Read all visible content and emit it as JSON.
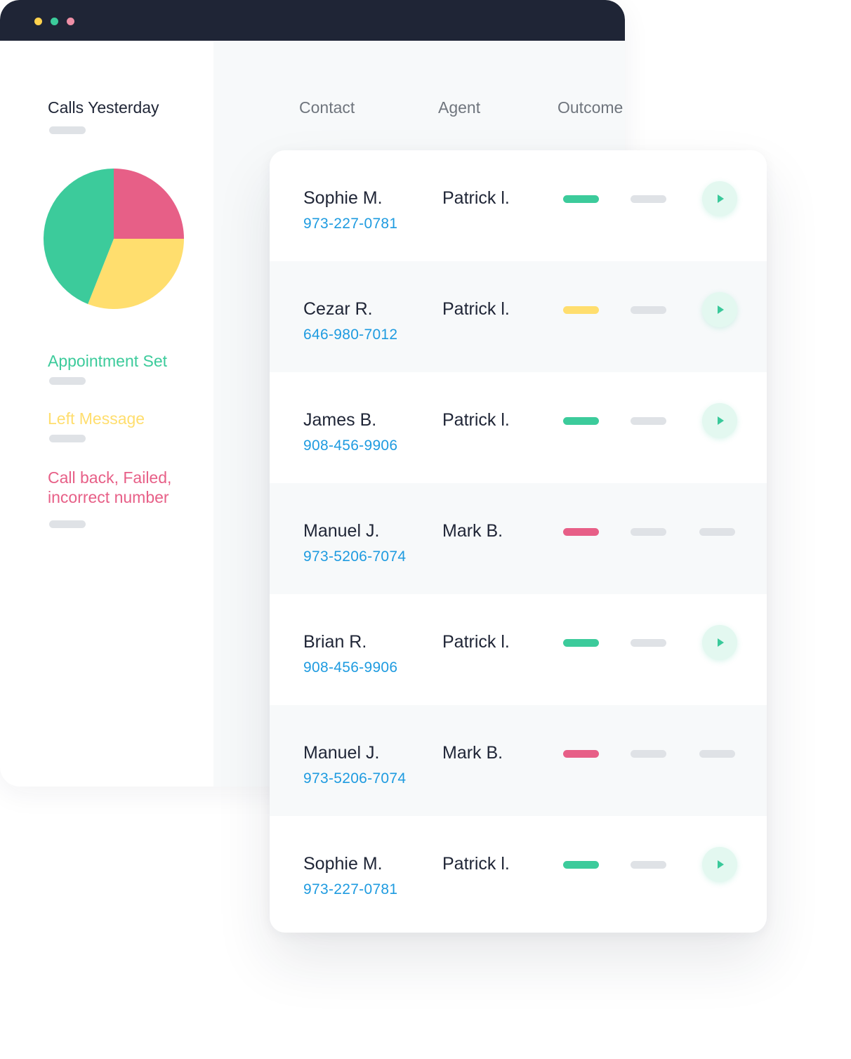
{
  "colors": {
    "titlebar": "#1f2536",
    "green": "#3ccb9b",
    "yellow": "#ffde6e",
    "pink": "#e75f87",
    "phone": "#1e9be0",
    "window_dots": [
      "#ffd24d",
      "#3ccb9b",
      "#ee8fa6"
    ]
  },
  "sidebar": {
    "title": "Calls Yesterday",
    "chart_data": {
      "type": "pie",
      "title": "Calls Yesterday",
      "slices": [
        {
          "label": "Call back, Failed, incorrect number",
          "value": 25,
          "color": "#e75f87"
        },
        {
          "label": "Left Message",
          "value": 31,
          "color": "#ffde6e"
        },
        {
          "label": "Appointment Set",
          "value": 44,
          "color": "#3ccb9b"
        }
      ]
    },
    "legend": [
      {
        "label": "Appointment Set",
        "color": "#3ccb9b"
      },
      {
        "label": "Left Message",
        "color": "#ffde6e"
      },
      {
        "label": "Call back, Failed, incorrect number",
        "color": "#e75f87"
      }
    ]
  },
  "table": {
    "headers": {
      "contact": "Contact",
      "agent": "Agent",
      "outcome": "Outcome"
    },
    "rows": [
      {
        "contact": "Sophie M.",
        "phone": "973-227-0781",
        "agent": "Patrick l.",
        "outcome": "green",
        "has_recording": true
      },
      {
        "contact": "Cezar R.",
        "phone": "646-980-7012",
        "agent": "Patrick l.",
        "outcome": "yellow",
        "has_recording": true
      },
      {
        "contact": "James B.",
        "phone": "908-456-9906",
        "agent": "Patrick l.",
        "outcome": "green",
        "has_recording": true
      },
      {
        "contact": "Manuel J.",
        "phone": "973-5206-7074",
        "agent": "Mark B.",
        "outcome": "pink",
        "has_recording": false
      },
      {
        "contact": "Brian R.",
        "phone": "908-456-9906",
        "agent": "Patrick l.",
        "outcome": "green",
        "has_recording": true
      },
      {
        "contact": "Manuel J.",
        "phone": "973-5206-7074",
        "agent": "Mark B.",
        "outcome": "pink",
        "has_recording": false
      },
      {
        "contact": "Sophie M.",
        "phone": "973-227-0781",
        "agent": "Patrick l.",
        "outcome": "green",
        "has_recording": true
      }
    ]
  }
}
